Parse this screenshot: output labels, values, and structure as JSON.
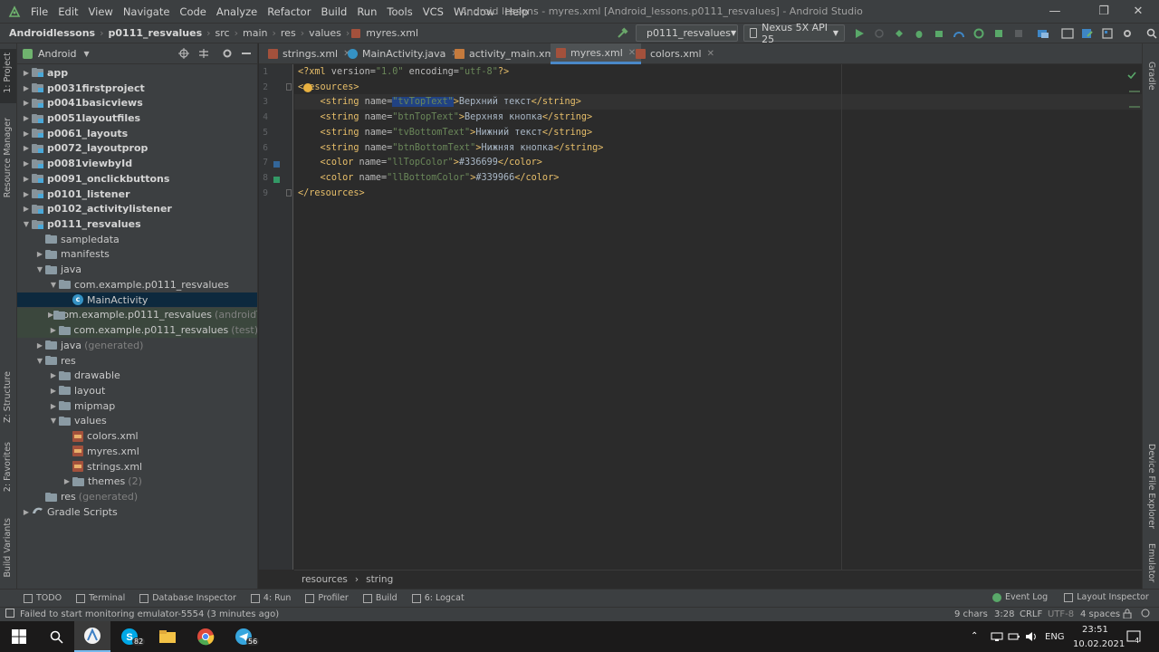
{
  "menu": [
    "File",
    "Edit",
    "View",
    "Navigate",
    "Code",
    "Analyze",
    "Refactor",
    "Build",
    "Run",
    "Tools",
    "VCS",
    "Window",
    "Help"
  ],
  "window_title": "Android lessons - myres.xml [Android_lessons.p0111_resvalues] - Android Studio",
  "breadcrumbs": [
    "Androidlessons",
    "p0111_resvalues",
    "src",
    "main",
    "res",
    "values",
    "myres.xml"
  ],
  "toolbar": {
    "config": "p0111_resvalues",
    "device": "Nexus 5X API 25"
  },
  "project_panel": {
    "view_mode": "Android",
    "tree": [
      {
        "label": "app",
        "depth": 0,
        "arrow": "right",
        "icon": "module",
        "bold": true
      },
      {
        "label": "p0031firstproject",
        "depth": 0,
        "arrow": "right",
        "icon": "module",
        "bold": true
      },
      {
        "label": "p0041basicviews",
        "depth": 0,
        "arrow": "right",
        "icon": "module",
        "bold": true
      },
      {
        "label": "p0051layoutfiles",
        "depth": 0,
        "arrow": "right",
        "icon": "module",
        "bold": true
      },
      {
        "label": "p0061_layouts",
        "depth": 0,
        "arrow": "right",
        "icon": "module",
        "bold": true
      },
      {
        "label": "p0072_layoutprop",
        "depth": 0,
        "arrow": "right",
        "icon": "module",
        "bold": true
      },
      {
        "label": "p0081viewbyId",
        "depth": 0,
        "arrow": "right",
        "icon": "module",
        "bold": true
      },
      {
        "label": "p0091_onclickbuttons",
        "depth": 0,
        "arrow": "right",
        "icon": "module",
        "bold": true
      },
      {
        "label": "p0101_listener",
        "depth": 0,
        "arrow": "right",
        "icon": "module",
        "bold": true
      },
      {
        "label": "p0102_activitylistener",
        "depth": 0,
        "arrow": "right",
        "icon": "module",
        "bold": true
      },
      {
        "label": "p0111_resvalues",
        "depth": 0,
        "arrow": "down",
        "icon": "module",
        "bold": true
      },
      {
        "label": "sampledata",
        "depth": 1,
        "arrow": "",
        "icon": "folder"
      },
      {
        "label": "manifests",
        "depth": 1,
        "arrow": "right",
        "icon": "folder"
      },
      {
        "label": "java",
        "depth": 1,
        "arrow": "down",
        "icon": "folder"
      },
      {
        "label": "com.example.p0111_resvalues",
        "depth": 2,
        "arrow": "down",
        "icon": "folder"
      },
      {
        "label": "MainActivity",
        "depth": 3,
        "arrow": "",
        "icon": "class",
        "selected": true
      },
      {
        "label": "com.example.p0111_resvalues",
        "suffix": "(androidTest)",
        "depth": 2,
        "arrow": "right",
        "icon": "folder",
        "greenish": true
      },
      {
        "label": "com.example.p0111_resvalues",
        "suffix": "(test)",
        "depth": 2,
        "arrow": "right",
        "icon": "folder",
        "greenish": true
      },
      {
        "label": "java",
        "suffix": "(generated)",
        "depth": 1,
        "arrow": "right",
        "icon": "folder"
      },
      {
        "label": "res",
        "depth": 1,
        "arrow": "down",
        "icon": "folder"
      },
      {
        "label": "drawable",
        "depth": 2,
        "arrow": "right",
        "icon": "folder"
      },
      {
        "label": "layout",
        "depth": 2,
        "arrow": "right",
        "icon": "folder"
      },
      {
        "label": "mipmap",
        "depth": 2,
        "arrow": "right",
        "icon": "folder"
      },
      {
        "label": "values",
        "depth": 2,
        "arrow": "down",
        "icon": "folder"
      },
      {
        "label": "colors.xml",
        "depth": 3,
        "arrow": "",
        "icon": "xml"
      },
      {
        "label": "myres.xml",
        "depth": 3,
        "arrow": "",
        "icon": "xml"
      },
      {
        "label": "strings.xml",
        "depth": 3,
        "arrow": "",
        "icon": "xml"
      },
      {
        "label": "themes",
        "suffix": "(2)",
        "depth": 3,
        "arrow": "right",
        "icon": "folder"
      },
      {
        "label": "res",
        "suffix": "(generated)",
        "depth": 1,
        "arrow": "",
        "icon": "folder"
      },
      {
        "label": "Gradle Scripts",
        "depth": 0,
        "arrow": "right",
        "icon": "gradle"
      }
    ]
  },
  "left_tabs": [
    "1: Project",
    "Resource Manager",
    "Z: Structure",
    "2: Favorites",
    "Build Variants"
  ],
  "right_tabs": [
    "Gradle",
    "Device File Explorer",
    "Emulator"
  ],
  "editor_tabs": [
    {
      "label": "strings.xml",
      "type": "xml",
      "active": false
    },
    {
      "label": "MainActivity.java",
      "type": "class",
      "active": false
    },
    {
      "label": "activity_main.xml",
      "type": "layout",
      "active": false
    },
    {
      "label": "myres.xml",
      "type": "xml",
      "active": true
    },
    {
      "label": "colors.xml",
      "type": "xml",
      "active": false
    }
  ],
  "line_numbers": [
    "1",
    "2",
    "3",
    "4",
    "5",
    "6",
    "7",
    "8",
    "9"
  ],
  "code_lines": [
    {
      "indent": "",
      "tag_open": "<?xml",
      "attr1": " version=",
      "val1": "\"1.0\"",
      "attr2": " encoding=",
      "val2": "\"utf-8\"",
      "close": "?>",
      "text": "",
      "end": ""
    },
    {
      "indent": "",
      "tag_open": "<resources>",
      "attr1": "",
      "val1": "",
      "attr2": "",
      "val2": "",
      "close": "",
      "text": "",
      "end": ""
    },
    {
      "indent": "    ",
      "tag_open": "<string",
      "attr1": " name=",
      "val1": "\"tvTopText\"",
      "attr2": "",
      "val2": "",
      "close": ">",
      "text": "Верхний текст",
      "end": "</string>"
    },
    {
      "indent": "    ",
      "tag_open": "<string",
      "attr1": " name=",
      "val1": "\"btnTopText\"",
      "attr2": "",
      "val2": "",
      "close": ">",
      "text": "Верхняя кнопка",
      "end": "</string>"
    },
    {
      "indent": "    ",
      "tag_open": "<string",
      "attr1": " name=",
      "val1": "\"tvBottomText\"",
      "attr2": "",
      "val2": "",
      "close": ">",
      "text": "Нижний текст",
      "end": "</string>"
    },
    {
      "indent": "    ",
      "tag_open": "<string",
      "attr1": " name=",
      "val1": "\"btnBottomText\"",
      "attr2": "",
      "val2": "",
      "close": ">",
      "text": "Нижняя кнопка",
      "end": "</string>"
    },
    {
      "indent": "    ",
      "tag_open": "<color",
      "attr1": " name=",
      "val1": "\"llTopColor\"",
      "attr2": "",
      "val2": "",
      "close": ">",
      "text": "#336699",
      "end": "</color>"
    },
    {
      "indent": "    ",
      "tag_open": "<color",
      "attr1": " name=",
      "val1": "\"llBottomColor\"",
      "attr2": "",
      "val2": "",
      "close": ">",
      "text": "#339966",
      "end": "</color>"
    },
    {
      "indent": "",
      "tag_open": "</resources>",
      "attr1": "",
      "val1": "",
      "attr2": "",
      "val2": "",
      "close": "",
      "text": "",
      "end": ""
    }
  ],
  "gutter_swatches": [
    {
      "line": 7,
      "color": "#336699"
    },
    {
      "line": 8,
      "color": "#339966"
    }
  ],
  "editor_breadcrumb": [
    "resources",
    "string"
  ],
  "bottom_tools": [
    "TODO",
    "Terminal",
    "Database Inspector",
    "4: Run",
    "Profiler",
    "Build",
    "6: Logcat"
  ],
  "bottom_tools_right": [
    "Event Log",
    "Layout Inspector"
  ],
  "status": {
    "message": "Failed to start monitoring emulator-5554 (3 minutes ago)",
    "chars": "9 chars",
    "position": "3:28",
    "line_sep": "CRLF",
    "encoding": "UTF-8",
    "indent": "4 spaces"
  },
  "taskbar": {
    "skype_badge": "82",
    "telegram_badge": "56",
    "lang": "ENG",
    "time": "23:51",
    "date": "10.02.2021",
    "notifications": "4"
  }
}
